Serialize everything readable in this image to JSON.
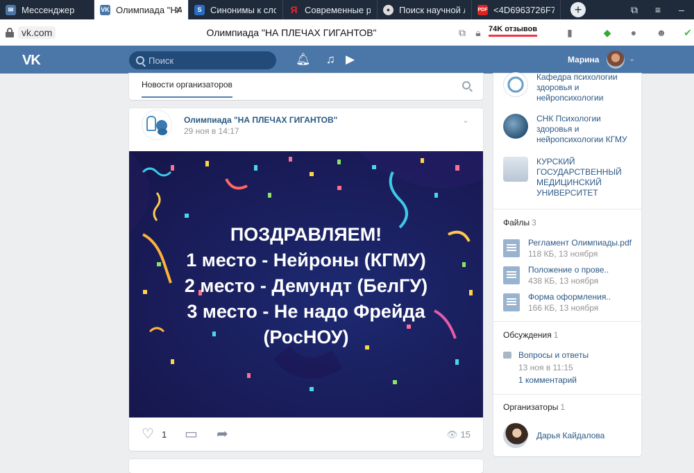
{
  "browser": {
    "tabs": [
      {
        "title": "Мессенджер",
        "icon": "vk-messenger-icon",
        "color": "#4a76a8",
        "active": false
      },
      {
        "title": "Олимпиада \"НА П",
        "icon": "vk-icon",
        "color": "#4a76a8",
        "active": true
      },
      {
        "title": "Синонимы к сло",
        "icon": "synonyms-site-icon",
        "color": "#2a6cc0",
        "active": false
      },
      {
        "title": "Современные р",
        "icon": "yandex-icon",
        "color": "#e23",
        "active": false
      },
      {
        "title": "Поиск научной л",
        "icon": "cyberleninka-icon",
        "color": "#333",
        "active": false
      },
      {
        "title": "<4D6963726F736",
        "icon": "pdf-icon",
        "color": "#d22",
        "active": false
      }
    ],
    "address": {
      "domain": "vk.com",
      "page_title": "Олимпиада \"НА ПЛЕЧАХ ГИГАНТОВ\"",
      "reviews": "74K отзывов"
    }
  },
  "header": {
    "logo": "VK",
    "search_placeholder": "Поиск",
    "user_name": "Марина"
  },
  "feed_tabs": {
    "active": "Новости организаторов"
  },
  "post": {
    "author": "Олимпиада \"НА ПЛЕЧАХ ГИГАНТОВ\"",
    "time": "29 ноя в 14:17",
    "image_text": [
      "ПОЗДРАВЛЯЕМ!",
      "1 место - Нейроны (КГМУ)",
      "2 место - Демундт (БелГУ)",
      "3 место - Не надо Фрейда",
      "(РосНОУ)"
    ],
    "likes": "1",
    "views": "15"
  },
  "sidebar": {
    "groups": [
      {
        "name": "Кафедра психологии здоровья и нейропсихологии",
        "color": "#6aa0c8"
      },
      {
        "name": "СНК Психологии здоровья и нейропсихологии КГМУ",
        "color": "#3d6a90"
      },
      {
        "name": "КУРСКИЙ ГОСУДАРСТВЕННЫЙ МЕДИЦИНСКИЙ УНИВЕРСИТЕТ",
        "color": "#b8c6d4"
      }
    ],
    "files": {
      "title": "Файлы",
      "count": "3",
      "items": [
        {
          "name": "Регламент Олимпиады.pdf",
          "meta": "118 КБ, 13 ноября"
        },
        {
          "name": "Положение о прове..",
          "meta": "438 КБ, 13 ноября"
        },
        {
          "name": "Форма оформления..",
          "meta": "166 КБ, 13 ноября"
        }
      ]
    },
    "discussions": {
      "title": "Обсуждения",
      "count": "1",
      "items": [
        {
          "name": "Вопросы и ответы",
          "date": "13 ноя в 11:15",
          "comments": "1 комментарий"
        }
      ]
    },
    "organizers": {
      "title": "Организаторы",
      "count": "1",
      "items": [
        {
          "name": "Дарья Кайдалова"
        }
      ]
    }
  }
}
